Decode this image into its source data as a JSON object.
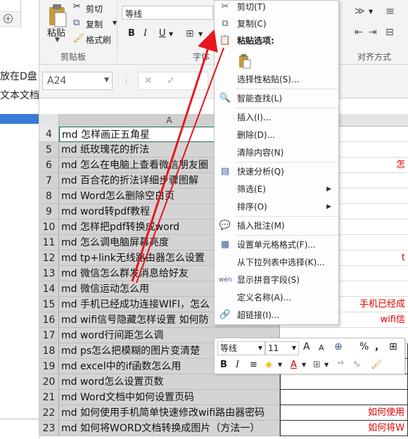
{
  "background_window": {
    "text_line1": "放在D盘",
    "text_line2": "文本文档",
    "circle_icon_label": "+"
  },
  "ribbon": {
    "paste_label": "粘贴",
    "cut_label": "剪切",
    "copy_label": "复制",
    "format_painter_label": "格式刷",
    "clipboard_group": "剪贴板",
    "font_name": "等线",
    "font_group": "字体",
    "bold": "B",
    "italic": "I",
    "underline": "U",
    "align_group": "对齐方式"
  },
  "formula_bar": {
    "name_box": "A24",
    "cancel": "✕",
    "enter": "✓"
  },
  "sheet": {
    "column_a": "A",
    "rows": [
      {
        "num": "4",
        "a": "md 怎样画正五角星",
        "b": "",
        "active": true
      },
      {
        "num": "5",
        "a": "md 纸玫瑰花的折法",
        "b": ""
      },
      {
        "num": "6",
        "a": "md 怎么在电脑上查看微信朋友圈",
        "b": "怎"
      },
      {
        "num": "7",
        "a": "md 百合花的折法详细步骤图解",
        "b": ""
      },
      {
        "num": "8",
        "a": "md Word怎么删除空白页",
        "b": ""
      },
      {
        "num": "9",
        "a": "md word转pdf教程",
        "b": ""
      },
      {
        "num": "10",
        "a": "md 怎样把pdf转换成word",
        "b": ""
      },
      {
        "num": "11",
        "a": "md 怎么调电脑屏幕亮度",
        "b": ""
      },
      {
        "num": "12",
        "a": "md tp+link无线路由器怎么设置",
        "b": "t"
      },
      {
        "num": "13",
        "a": "md 微信怎么群发消息给好友",
        "b": ""
      },
      {
        "num": "14",
        "a": "md 微信运动怎么用",
        "b": ""
      },
      {
        "num": "15",
        "a": "md 手机已经成功连接WIFI，怎么",
        "b": "手机已经成"
      },
      {
        "num": "16",
        "a": "md wifi信号隐藏怎样设置 如何防",
        "b": "wifi信"
      },
      {
        "num": "17",
        "a": "md word行间距怎么调",
        "b": ""
      },
      {
        "num": "18",
        "a": "md ps怎么把模糊的图片变清楚",
        "b": ""
      },
      {
        "num": "19",
        "a": "md excel中的if函数怎么用",
        "b": ""
      },
      {
        "num": "20",
        "a": "md word怎么设置页数",
        "b": ""
      },
      {
        "num": "21",
        "a": "md Word文档中如何设置页码",
        "b": ""
      },
      {
        "num": "22",
        "a": "md 如何使用手机简单快速修改wifi路由器密码",
        "b": "如何使用"
      },
      {
        "num": "23",
        "a": "md 如何将WORD文档转换成图片（方法一）",
        "b": "如何将W"
      }
    ]
  },
  "context_menu": {
    "cut": "剪切(T)",
    "copy": "复制(C)",
    "paste_options": "粘贴选项:",
    "paste_special": "选择性粘贴(S)...",
    "smart_lookup": "智能查找(L)",
    "insert": "插入(I)...",
    "delete": "删除(D)...",
    "clear_contents": "清除内容(N)",
    "quick_analysis": "快速分析(Q)",
    "filter": "筛选(E)",
    "sort": "排序(O)",
    "insert_comment": "插入批注(M)",
    "format_cells": "设置单元格格式(F)...",
    "pick_from_list": "从下拉列表中选择(K)...",
    "show_phonetic": "显示拼音字段(S)",
    "define_name": "定义名称(A)...",
    "hyperlink": "超链接(I)..."
  },
  "mini_toolbar": {
    "font": "等线",
    "size": "11",
    "grow": "A",
    "shrink": "A",
    "percent": "%",
    "comma": ",",
    "bold": "B",
    "italic": "I",
    "align": "≡"
  },
  "colors": {
    "annotation_arrow": "#e8161f",
    "error_text": "#e00000",
    "selection_gray": "#d4d4d4",
    "active_cell_border": "#217346"
  }
}
